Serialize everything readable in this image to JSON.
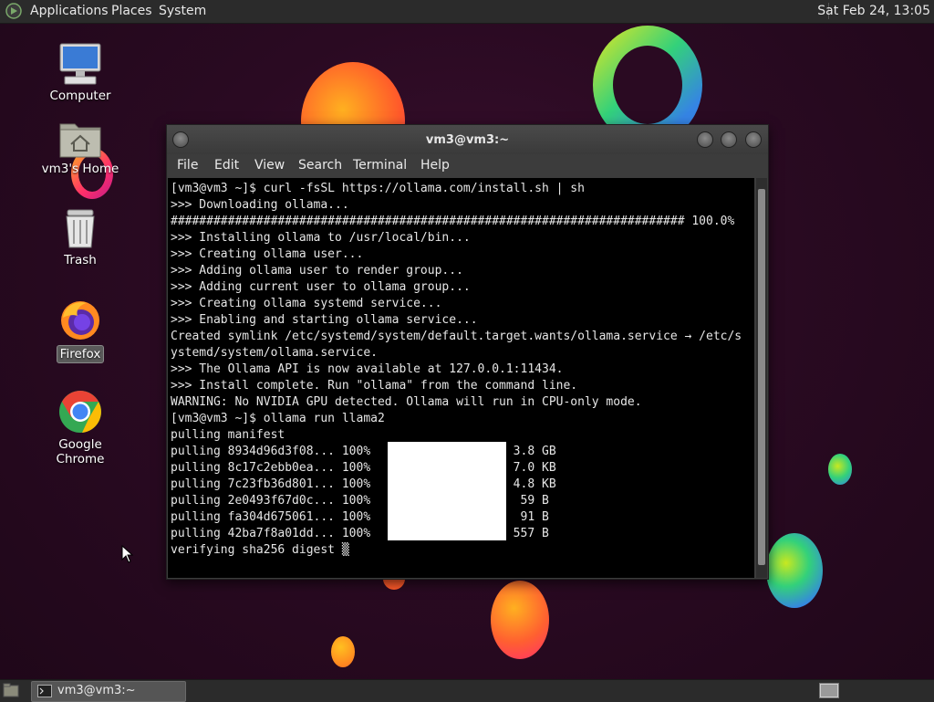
{
  "top_panel": {
    "menus": [
      "Applications",
      "Places",
      "System"
    ],
    "clock": "Sat Feb 24, 13:05"
  },
  "desktop": {
    "icons": [
      {
        "label": "Computer",
        "icon": "computer-icon"
      },
      {
        "label": "vm3's Home",
        "icon": "home-folder-icon"
      },
      {
        "label": "Trash",
        "icon": "trash-icon"
      },
      {
        "label": "Firefox",
        "icon": "firefox-icon"
      },
      {
        "label": "Google Chrome",
        "icon": "chrome-icon"
      }
    ]
  },
  "terminal": {
    "title": "vm3@vm3:~",
    "menu": [
      "File",
      "Edit",
      "View",
      "Search",
      "Terminal",
      "Help"
    ],
    "lines": [
      "[vm3@vm3 ~]$ curl -fsSL https://ollama.com/install.sh | sh",
      ">>> Downloading ollama...",
      "######################################################################## 100.0%",
      ">>> Installing ollama to /usr/local/bin...",
      ">>> Creating ollama user...",
      ">>> Adding ollama user to render group...",
      ">>> Adding current user to ollama group...",
      ">>> Creating ollama systemd service...",
      ">>> Enabling and starting ollama service...",
      "Created symlink /etc/systemd/system/default.target.wants/ollama.service → /etc/s",
      "ystemd/system/ollama.service.",
      ">>> The Ollama API is now available at 127.0.0.1:11434.",
      ">>> Install complete. Run \"ollama\" from the command line.",
      "WARNING: No NVIDIA GPU detected. Ollama will run in CPU-only mode.",
      "[vm3@vm3 ~]$ ollama run llama2",
      "pulling manifest",
      "pulling 8934d96d3f08... 100%                    3.8 GB",
      "pulling 8c17c2ebb0ea... 100%                    7.0 KB",
      "pulling 7c23fb36d801... 100%                    4.8 KB",
      "pulling 2e0493f67d0c... 100%                     59 B",
      "pulling fa304d675061... 100%                     91 B",
      "pulling 42ba7f8a01dd... 100%                    557 B",
      "verifying sha256 digest ▒"
    ]
  },
  "taskbar": {
    "task_label": "vm3@vm3:~"
  }
}
